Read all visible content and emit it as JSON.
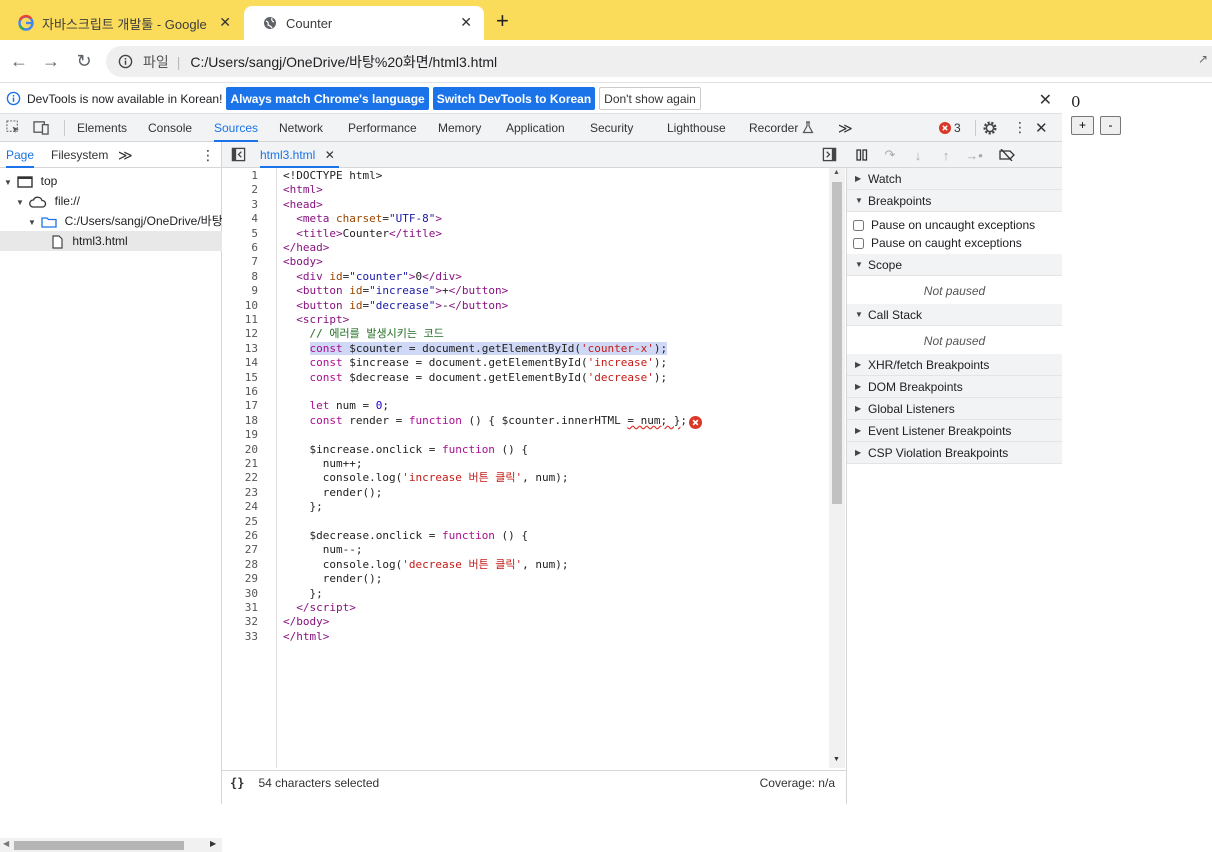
{
  "browser": {
    "tabs": [
      {
        "title": "자바스크립트 개발툴 - Google",
        "favicon": "google-favicon",
        "active": false
      },
      {
        "title": "Counter",
        "favicon": "globe-favicon",
        "active": true
      }
    ],
    "new_tab": "+",
    "address": {
      "site_label": "파일",
      "separator": "|",
      "url": "C:/Users/sangj/OneDrive/바탕%20화면/html3.html"
    }
  },
  "devtools": {
    "infobar": {
      "message": "DevTools is now available in Korean!",
      "btn_match": "Always match Chrome's language",
      "btn_switch": "Switch DevTools to Korean",
      "btn_dont": "Don't show again"
    },
    "tabs": [
      "Elements",
      "Console",
      "Sources",
      "Network",
      "Performance",
      "Memory",
      "Application",
      "Security",
      "Lighthouse",
      "Recorder"
    ],
    "active_tab": "Sources",
    "more": "≫",
    "error_count": "3",
    "navigator": {
      "tabs": [
        "Page",
        "Filesystem"
      ],
      "more": "≫",
      "tree": [
        "top",
        "file://",
        "C:/Users/sangj/OneDrive/바탕",
        "html3.html"
      ]
    },
    "editor": {
      "file_tab": "html3.html",
      "status": "54 characters selected",
      "coverage": "Coverage: n/a",
      "lines": [
        "1",
        "2",
        "3",
        "4",
        "5",
        "6",
        "7",
        "8",
        "9",
        "10",
        "11",
        "12",
        "13",
        "14",
        "15",
        "16",
        "17",
        "18",
        "19",
        "20",
        "21",
        "22",
        "23",
        "24",
        "25",
        "26",
        "27",
        "28",
        "29",
        "30",
        "31",
        "32",
        "33"
      ]
    },
    "debugger": {
      "watch": "Watch",
      "breakpoints": "Breakpoints",
      "pause_uncaught": "Pause on uncaught exceptions",
      "pause_caught": "Pause on caught exceptions",
      "scope": "Scope",
      "not_paused_scope": "Not paused",
      "call_stack": "Call Stack",
      "not_paused_stack": "Not paused",
      "xhr": "XHR/fetch Breakpoints",
      "dom": "DOM Breakpoints",
      "global": "Global Listeners",
      "event": "Event Listener Breakpoints",
      "csp": "CSP Violation Breakpoints"
    }
  },
  "page": {
    "counter": "0",
    "increase": "+",
    "decrease": "-"
  }
}
